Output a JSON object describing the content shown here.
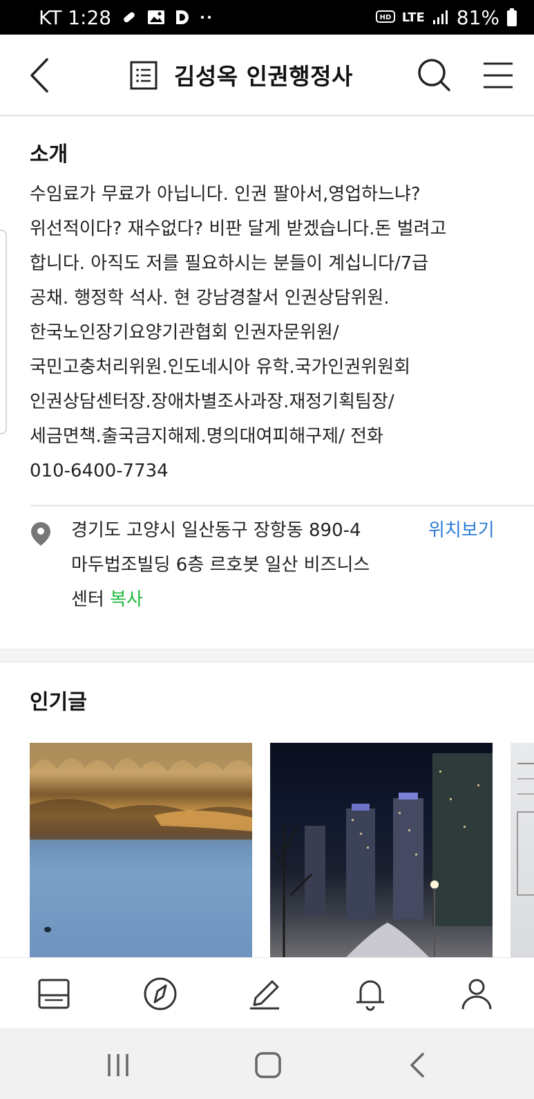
{
  "status_bar": {
    "carrier_time": "KT 1:28",
    "network": "LTE",
    "battery": "81%",
    "icons": [
      "pill-icon",
      "image-icon",
      "d-app-icon",
      "more-dots-icon",
      "hd-icon",
      "signal-icon",
      "battery-icon"
    ]
  },
  "header": {
    "title": "김성옥 인권행정사",
    "icons": [
      "back-icon",
      "document-list-icon",
      "search-icon",
      "menu-icon"
    ]
  },
  "intro": {
    "heading": "소개",
    "lines": [
      "수임료가 무료가 아닙니다. 인권 팔아서,영업하느냐?",
      "위선적이다? 재수없다? 비판 달게 받겠습니다.돈 벌려고",
      "합니다. 아직도 저를 필요하시는 분들이 계십니다/7급",
      "공채. 행정학 석사. 현 강남경찰서 인권상담위원.",
      "한국노인장기요양기관협회 인권자문위원/",
      "국민고충처리위원.인도네시아 유학.국가인권위원회",
      "인권상담센터장.장애차별조사과장.재정기획팀장/",
      "세금면책.출국금지해제.명의대여피해구제/ 전화",
      "010-6400-7734"
    ]
  },
  "address": {
    "lines": [
      "경기도 고양시 일산동구 장항동 890-4",
      "마두법조빌딩 6층 르호봇 일산 비즈니스",
      "센터"
    ],
    "copy_label": "복사",
    "map_label": "위치보기",
    "link_color": "#2b7bd6",
    "copy_color": "#1fb73d"
  },
  "popular": {
    "heading": "인기글",
    "thumbnails": [
      "thumb-lake",
      "thumb-night-city",
      "thumb-document"
    ]
  },
  "bottom_nav": {
    "items": [
      "board-icon",
      "compass-icon",
      "pencil-icon",
      "bell-icon",
      "person-icon"
    ]
  },
  "system_nav": {
    "items": [
      "recent-apps-icon",
      "home-icon",
      "back-nav-icon"
    ]
  }
}
